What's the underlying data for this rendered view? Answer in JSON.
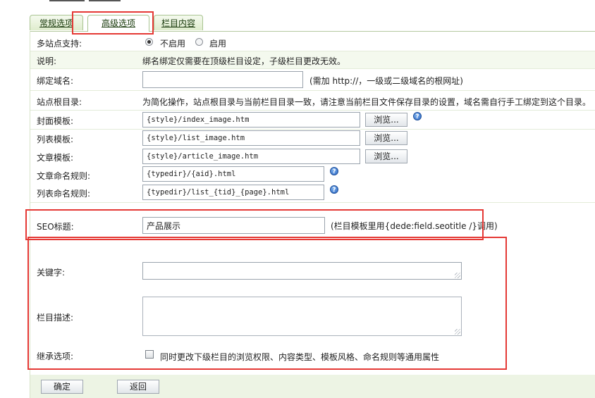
{
  "tabs": [
    {
      "label": "常规选项",
      "active": false
    },
    {
      "label": "高级选项",
      "active": true
    },
    {
      "label": "栏目内容",
      "active": false
    }
  ],
  "multisite": {
    "label": "多站点支持:",
    "options": [
      "不启用",
      "启用"
    ],
    "selected": "不启用"
  },
  "note": {
    "label": "说明:",
    "text": "绑名绑定仅需要在顶级栏目设定，子级栏目更改无效。"
  },
  "bind_domain": {
    "label": "绑定域名:",
    "value": "",
    "hint": "(需加 http://，一级或二级域名的根网址)"
  },
  "site_root": {
    "label": "站点根目录:",
    "text": "为简化操作，站点根目录与当前栏目目录一致，请注意当前栏目文件保存目录的设置，域名需自行手工绑定到这个目录。"
  },
  "templates": {
    "cover": {
      "label": "封面模板:",
      "value": "{style}/index_image.htm",
      "browse": "浏览..."
    },
    "list": {
      "label": "列表模板:",
      "value": "{style}/list_image.htm",
      "browse": "浏览..."
    },
    "article": {
      "label": "文章模板:",
      "value": "{style}/article_image.htm",
      "browse": "浏览..."
    }
  },
  "naming": {
    "article": {
      "label": "文章命名规则:",
      "value": "{typedir}/{aid}.html"
    },
    "list": {
      "label": "列表命名规则:",
      "value": "{typedir}/list_{tid}_{page}.html"
    }
  },
  "seo": {
    "label": "SEO标题:",
    "value": "产品展示",
    "hint": "(栏目模板里用{dede:field.seotitle /}调用)"
  },
  "keywords": {
    "label": "关键字:",
    "value": ""
  },
  "description": {
    "label": "栏目描述:",
    "value": ""
  },
  "inherit": {
    "label": "继承选项:",
    "checked": false,
    "text": "同时更改下级栏目的浏览权限、内容类型、模板风格、命名规则等通用属性"
  },
  "footer": {
    "confirm": "确定",
    "back": "返回"
  },
  "icons": {
    "help": "question-help-icon"
  },
  "colors": {
    "highlight": "#e53935",
    "tab_border": "#a9c491",
    "row_shade": "#f4f9ee"
  }
}
